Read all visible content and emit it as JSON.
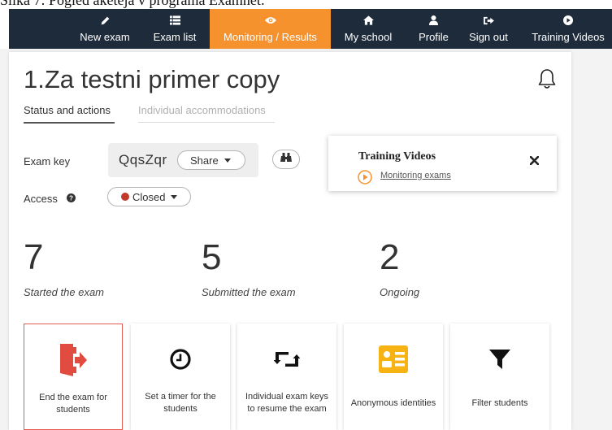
{
  "caption": "Slika 7: Pogled aketeja v programa Examnet:",
  "nav": {
    "items": [
      {
        "label": "New exam",
        "icon": "pencil-icon"
      },
      {
        "label": "Exam list",
        "icon": "list-icon"
      },
      {
        "label": "Monitoring / Results",
        "icon": "eye-icon",
        "active": true
      },
      {
        "label": "My school",
        "icon": "home-icon"
      },
      {
        "label": "Profile",
        "icon": "user-icon"
      },
      {
        "label": "Sign out",
        "icon": "sign-out-icon"
      },
      {
        "label": "Training Videos",
        "icon": "play-circle-icon"
      }
    ],
    "bg_color": "#1e2b3b",
    "active_color": "#f5922e"
  },
  "exam": {
    "title": "1.Za testni primer copy"
  },
  "tabs": {
    "status": "Status and actions",
    "accommodations": "Individual accommodations"
  },
  "fields": {
    "exam_key_label": "Exam key",
    "exam_key_value": "QqsZqr",
    "share_label": "Share",
    "access_label": "Access",
    "access_value": "Closed",
    "access_color": "#c0392b"
  },
  "popup": {
    "title": "Training Videos",
    "link": "Monitoring exams"
  },
  "stats": [
    {
      "value": "7",
      "label": "Started the exam"
    },
    {
      "value": "5",
      "label": "Submitted the exam"
    },
    {
      "value": "2",
      "label": "Ongoing"
    }
  ],
  "actions": [
    {
      "label": "End the exam for students",
      "icon": "exit-door-icon",
      "color": "#e24b3f"
    },
    {
      "label": "Set a timer for the students",
      "icon": "clock-icon",
      "color": "#111111"
    },
    {
      "label": "Individual exam keys to resume the exam",
      "icon": "retweet-icon",
      "color": "#111111"
    },
    {
      "label": "Anonymous identities",
      "icon": "id-card-icon",
      "color": "#f7b314"
    },
    {
      "label": "Filter students",
      "icon": "filter-icon",
      "color": "#111111"
    }
  ]
}
